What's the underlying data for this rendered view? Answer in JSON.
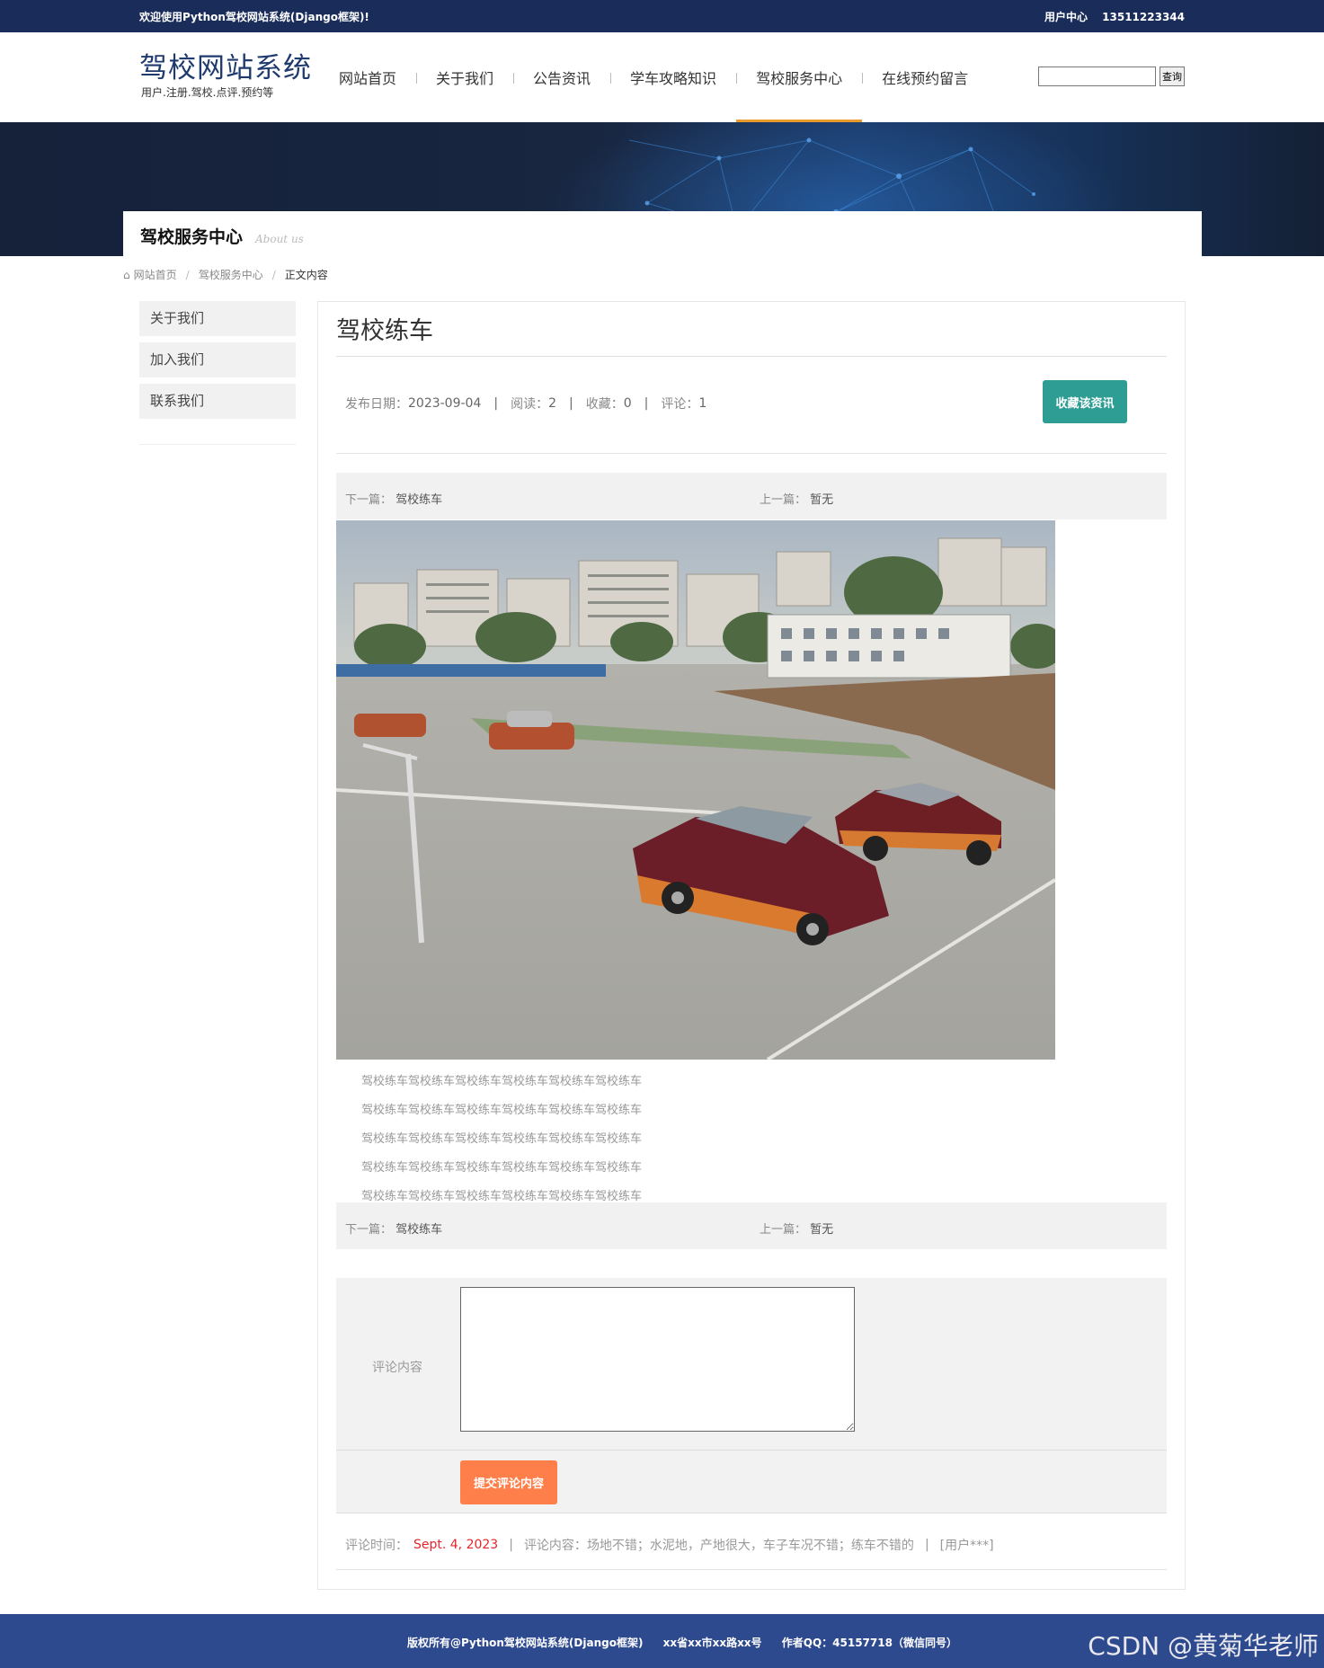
{
  "topbar": {
    "welcome": "欢迎使用Python驾校网站系统(Django框架)!",
    "user_center": "用户中心",
    "phone": "13511223344"
  },
  "header": {
    "site_title": "驾校网站系统",
    "site_subtitle": "用户.注册.驾校.点评.预约等",
    "nav": [
      "网站首页",
      "关于我们",
      "公告资讯",
      "学车攻略知识",
      "驾校服务中心",
      "在线预约留言"
    ],
    "active_nav": "驾校服务中心",
    "search_placeholder": "",
    "search_button": "查询"
  },
  "banner": {
    "title": "驾校服务中心",
    "subtitle": "About us"
  },
  "breadcrumb": [
    "网站首页",
    "驾校服务中心",
    "正文内容"
  ],
  "sidebar": [
    "关于我们",
    "加入我们",
    "联系我们"
  ],
  "article": {
    "title": "驾校练车",
    "date_label": "发布日期：",
    "date": "2023-09-04",
    "read_label": "阅读：",
    "read": "2",
    "fav_label": "收藏：",
    "fav": "0",
    "comment_label": "评论：",
    "comment_count": "1",
    "fav_button": "收藏该资讯",
    "prev_label": "下一篇：",
    "prev_value": "驾校练车",
    "next_label": "上一篇：",
    "next_value": "暂无",
    "image_alt": "driving-school-practice-photo",
    "paragraphs": [
      "驾校练车驾校练车驾校练车驾校练车驾校练车驾校练车",
      "驾校练车驾校练车驾校练车驾校练车驾校练车驾校练车",
      "驾校练车驾校练车驾校练车驾校练车驾校练车驾校练车",
      "驾校练车驾校练车驾校练车驾校练车驾校练车驾校练车",
      "驾校练车驾校练车驾校练车驾校练车驾校练车驾校练车"
    ]
  },
  "comment_form": {
    "label": "评论内容",
    "value": "",
    "submit": "提交评论内容"
  },
  "comments": [
    {
      "time_label": "评论时间：",
      "time": "Sept. 4, 2023",
      "content_label": "评论内容：",
      "content": "场地不错；水泥地，产地很大，车子车况不错；练车不错的",
      "user": "[用户***]"
    }
  ],
  "footer": {
    "copyright": "版权所有@Python驾校网站系统(Django框架)",
    "address": "xx省xx市xx路xx号",
    "qq": "作者QQ：45157718（微信同号）",
    "watermark": "CSDN @黄菊华老师"
  },
  "colors": {
    "topbar": "#1a2d5a",
    "nav_active": "#e89a2c",
    "fav_button": "#2e9d94",
    "submit_button": "#ff7f4a",
    "comment_date": "#e8242a",
    "footer": "#2e4a8f"
  }
}
